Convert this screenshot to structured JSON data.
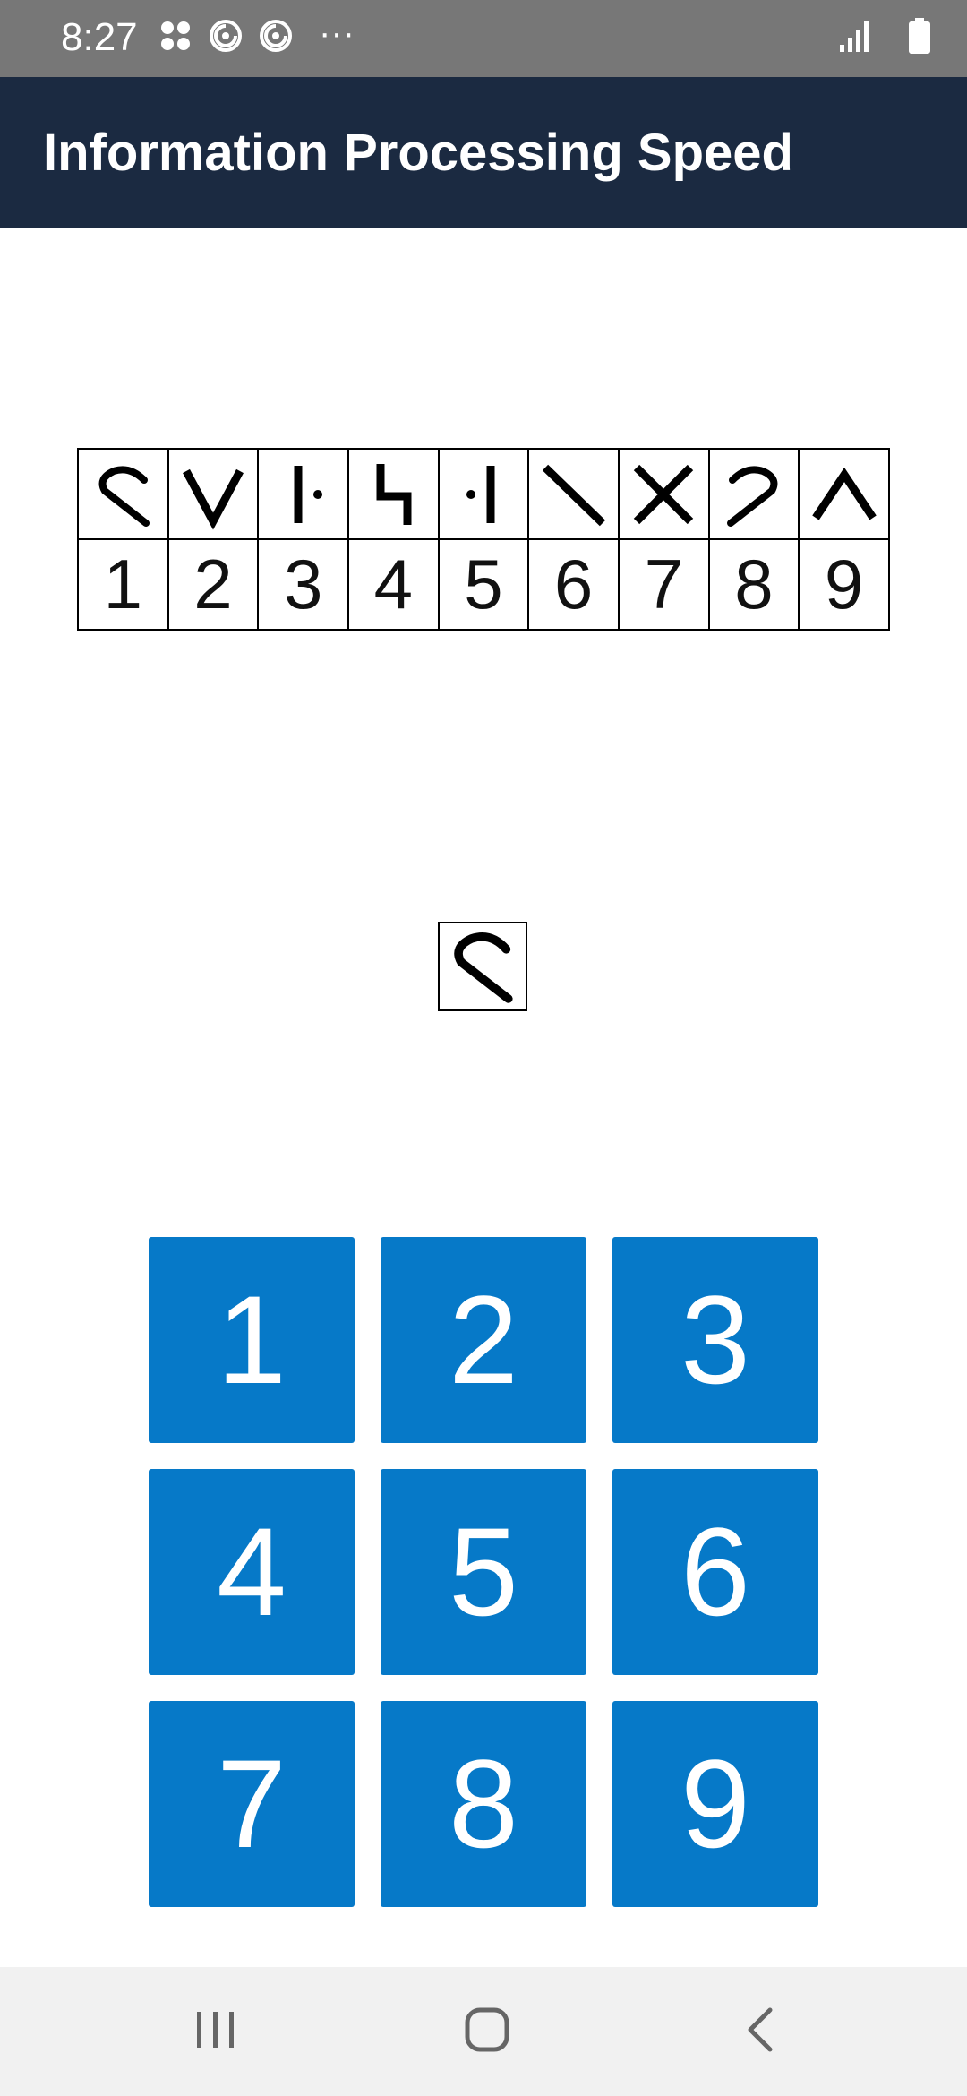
{
  "status_bar": {
    "time": "8:27",
    "left_icons": [
      "apps-grid-icon",
      "notification-swirl-icon",
      "notification-swirl-icon-2"
    ],
    "more": "···",
    "right_icons": [
      "signal-icon",
      "battery-icon"
    ]
  },
  "app_bar": {
    "title": "Information Processing Speed"
  },
  "key": {
    "symbols": [
      "hook-left-symbol",
      "v-symbol",
      "bar-dot-right-symbol",
      "step-symbol",
      "dot-bar-symbol",
      "backslash-symbol",
      "x-symbol",
      "hook-right-symbol",
      "caret-symbol"
    ],
    "numbers": [
      "1",
      "2",
      "3",
      "4",
      "5",
      "6",
      "7",
      "8",
      "9"
    ]
  },
  "stimulus": {
    "symbol": "hook-left-symbol"
  },
  "keypad": {
    "keys": [
      "1",
      "2",
      "3",
      "4",
      "5",
      "6",
      "7",
      "8",
      "9"
    ]
  },
  "nav_bar": {
    "buttons": [
      "recent-apps-icon",
      "home-icon",
      "back-icon"
    ]
  },
  "colors": {
    "status_bar": "#777777",
    "app_bar": "#1b2a41",
    "key_button": "#0679c8",
    "nav_bar": "#f1f1f1"
  }
}
